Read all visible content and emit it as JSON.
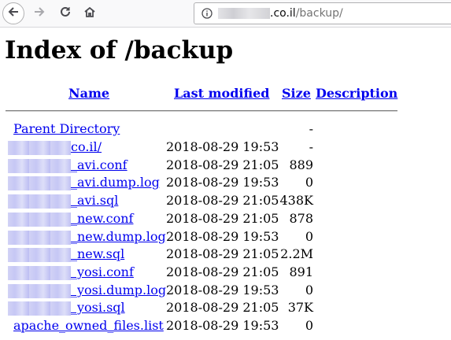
{
  "browser": {
    "url_domain_suffix": ".co.il",
    "url_path": "/backup/"
  },
  "page": {
    "title": "Index of /backup",
    "columns": {
      "name": "Name",
      "last_modified": "Last modified",
      "size": "Size",
      "description": "Description"
    },
    "parent": {
      "label": "Parent Directory",
      "size": "-"
    },
    "rows": [
      {
        "name": "co.il/",
        "modified": "2018-08-29 19:53",
        "size": "-"
      },
      {
        "name": "_avi.conf",
        "modified": "2018-08-29 21:05",
        "size": "889"
      },
      {
        "name": "_avi.dump.log",
        "modified": "2018-08-29 19:53",
        "size": "0"
      },
      {
        "name": "_avi.sql",
        "modified": "2018-08-29 21:05",
        "size": "438K"
      },
      {
        "name": "_new.conf",
        "modified": "2018-08-29 21:05",
        "size": "878"
      },
      {
        "name": "_new.dump.log",
        "modified": "2018-08-29 19:53",
        "size": "0"
      },
      {
        "name": "_new.sql",
        "modified": "2018-08-29 21:05",
        "size": "2.2M"
      },
      {
        "name": "_yosi.conf",
        "modified": "2018-08-29 21:05",
        "size": "891"
      },
      {
        "name": "_yosi.dump.log",
        "modified": "2018-08-29 19:53",
        "size": "0"
      },
      {
        "name": "_yosi.sql",
        "modified": "2018-08-29 21:05",
        "size": "37K"
      },
      {
        "name": "apache_owned_files.list",
        "modified": "2018-08-29 19:53",
        "size": "0"
      }
    ]
  }
}
